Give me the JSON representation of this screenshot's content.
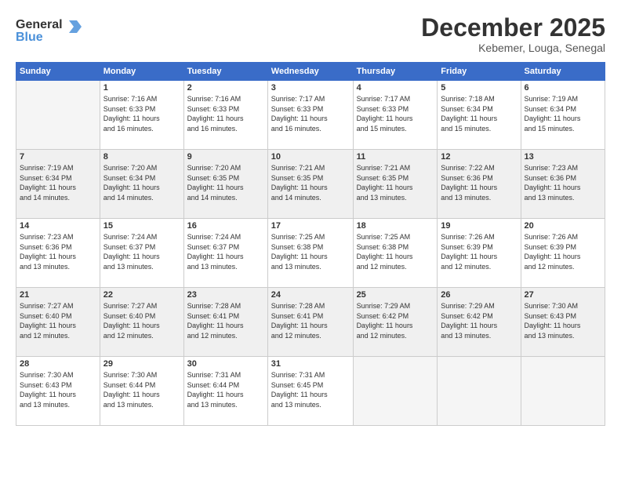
{
  "logo": {
    "line1": "General",
    "line2": "Blue"
  },
  "title": "December 2025",
  "subtitle": "Kebemer, Louga, Senegal",
  "days_of_week": [
    "Sunday",
    "Monday",
    "Tuesday",
    "Wednesday",
    "Thursday",
    "Friday",
    "Saturday"
  ],
  "weeks": [
    [
      {
        "day": "",
        "info": ""
      },
      {
        "day": "1",
        "info": "Sunrise: 7:16 AM\nSunset: 6:33 PM\nDaylight: 11 hours\nand 16 minutes."
      },
      {
        "day": "2",
        "info": "Sunrise: 7:16 AM\nSunset: 6:33 PM\nDaylight: 11 hours\nand 16 minutes."
      },
      {
        "day": "3",
        "info": "Sunrise: 7:17 AM\nSunset: 6:33 PM\nDaylight: 11 hours\nand 16 minutes."
      },
      {
        "day": "4",
        "info": "Sunrise: 7:17 AM\nSunset: 6:33 PM\nDaylight: 11 hours\nand 15 minutes."
      },
      {
        "day": "5",
        "info": "Sunrise: 7:18 AM\nSunset: 6:34 PM\nDaylight: 11 hours\nand 15 minutes."
      },
      {
        "day": "6",
        "info": "Sunrise: 7:19 AM\nSunset: 6:34 PM\nDaylight: 11 hours\nand 15 minutes."
      }
    ],
    [
      {
        "day": "7",
        "info": "Sunrise: 7:19 AM\nSunset: 6:34 PM\nDaylight: 11 hours\nand 14 minutes."
      },
      {
        "day": "8",
        "info": "Sunrise: 7:20 AM\nSunset: 6:34 PM\nDaylight: 11 hours\nand 14 minutes."
      },
      {
        "day": "9",
        "info": "Sunrise: 7:20 AM\nSunset: 6:35 PM\nDaylight: 11 hours\nand 14 minutes."
      },
      {
        "day": "10",
        "info": "Sunrise: 7:21 AM\nSunset: 6:35 PM\nDaylight: 11 hours\nand 14 minutes."
      },
      {
        "day": "11",
        "info": "Sunrise: 7:21 AM\nSunset: 6:35 PM\nDaylight: 11 hours\nand 13 minutes."
      },
      {
        "day": "12",
        "info": "Sunrise: 7:22 AM\nSunset: 6:36 PM\nDaylight: 11 hours\nand 13 minutes."
      },
      {
        "day": "13",
        "info": "Sunrise: 7:23 AM\nSunset: 6:36 PM\nDaylight: 11 hours\nand 13 minutes."
      }
    ],
    [
      {
        "day": "14",
        "info": "Sunrise: 7:23 AM\nSunset: 6:36 PM\nDaylight: 11 hours\nand 13 minutes."
      },
      {
        "day": "15",
        "info": "Sunrise: 7:24 AM\nSunset: 6:37 PM\nDaylight: 11 hours\nand 13 minutes."
      },
      {
        "day": "16",
        "info": "Sunrise: 7:24 AM\nSunset: 6:37 PM\nDaylight: 11 hours\nand 13 minutes."
      },
      {
        "day": "17",
        "info": "Sunrise: 7:25 AM\nSunset: 6:38 PM\nDaylight: 11 hours\nand 13 minutes."
      },
      {
        "day": "18",
        "info": "Sunrise: 7:25 AM\nSunset: 6:38 PM\nDaylight: 11 hours\nand 12 minutes."
      },
      {
        "day": "19",
        "info": "Sunrise: 7:26 AM\nSunset: 6:39 PM\nDaylight: 11 hours\nand 12 minutes."
      },
      {
        "day": "20",
        "info": "Sunrise: 7:26 AM\nSunset: 6:39 PM\nDaylight: 11 hours\nand 12 minutes."
      }
    ],
    [
      {
        "day": "21",
        "info": "Sunrise: 7:27 AM\nSunset: 6:40 PM\nDaylight: 11 hours\nand 12 minutes."
      },
      {
        "day": "22",
        "info": "Sunrise: 7:27 AM\nSunset: 6:40 PM\nDaylight: 11 hours\nand 12 minutes."
      },
      {
        "day": "23",
        "info": "Sunrise: 7:28 AM\nSunset: 6:41 PM\nDaylight: 11 hours\nand 12 minutes."
      },
      {
        "day": "24",
        "info": "Sunrise: 7:28 AM\nSunset: 6:41 PM\nDaylight: 11 hours\nand 12 minutes."
      },
      {
        "day": "25",
        "info": "Sunrise: 7:29 AM\nSunset: 6:42 PM\nDaylight: 11 hours\nand 12 minutes."
      },
      {
        "day": "26",
        "info": "Sunrise: 7:29 AM\nSunset: 6:42 PM\nDaylight: 11 hours\nand 13 minutes."
      },
      {
        "day": "27",
        "info": "Sunrise: 7:30 AM\nSunset: 6:43 PM\nDaylight: 11 hours\nand 13 minutes."
      }
    ],
    [
      {
        "day": "28",
        "info": "Sunrise: 7:30 AM\nSunset: 6:43 PM\nDaylight: 11 hours\nand 13 minutes."
      },
      {
        "day": "29",
        "info": "Sunrise: 7:30 AM\nSunset: 6:44 PM\nDaylight: 11 hours\nand 13 minutes."
      },
      {
        "day": "30",
        "info": "Sunrise: 7:31 AM\nSunset: 6:44 PM\nDaylight: 11 hours\nand 13 minutes."
      },
      {
        "day": "31",
        "info": "Sunrise: 7:31 AM\nSunset: 6:45 PM\nDaylight: 11 hours\nand 13 minutes."
      },
      {
        "day": "",
        "info": ""
      },
      {
        "day": "",
        "info": ""
      },
      {
        "day": "",
        "info": ""
      }
    ]
  ]
}
